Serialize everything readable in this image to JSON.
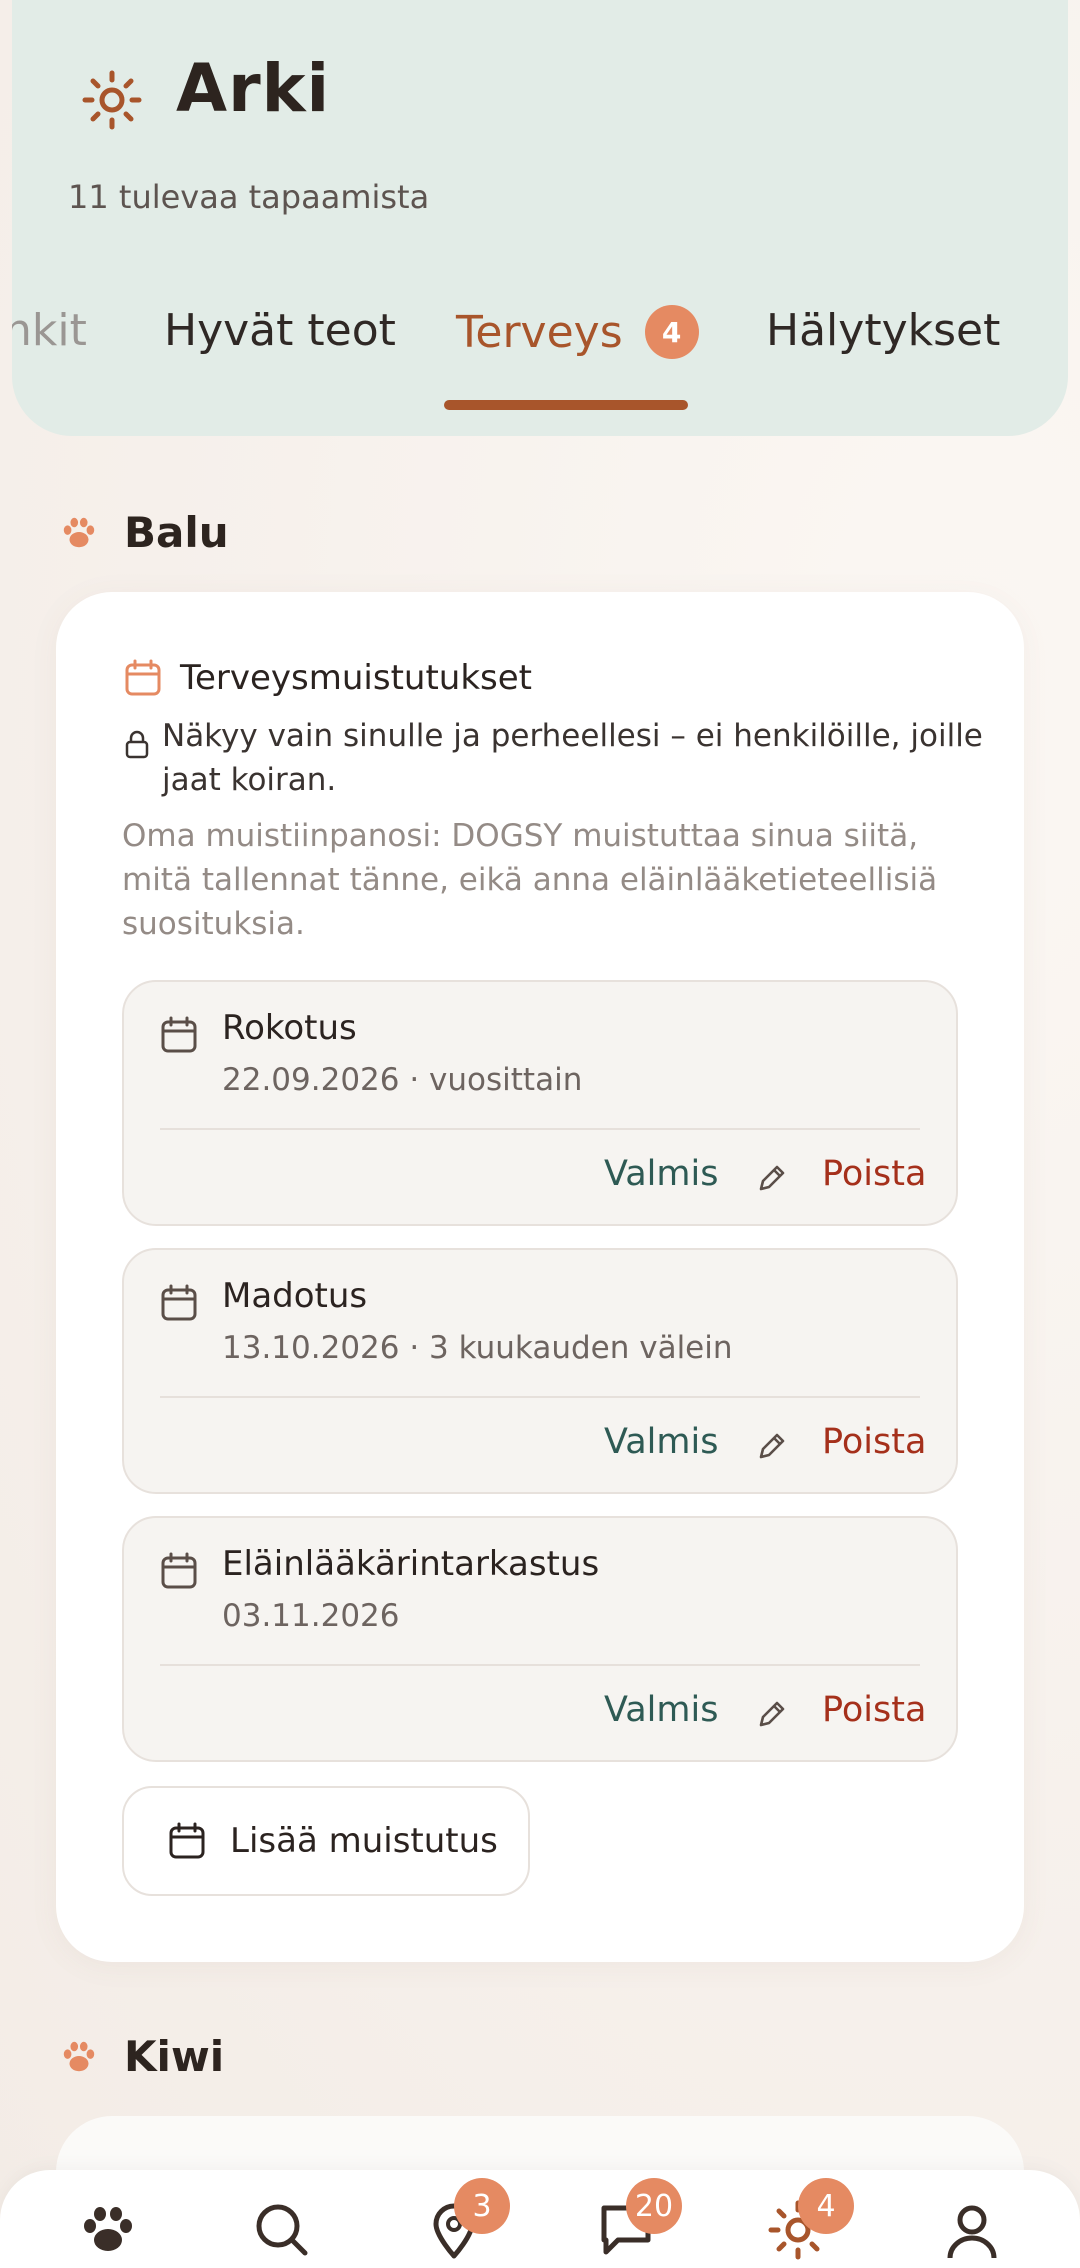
{
  "header": {
    "title": "Arki",
    "subtitle": "11 tulevaa tapaamista",
    "icon": "sun-icon"
  },
  "tabs": [
    {
      "label": "nkit",
      "state": "partial"
    },
    {
      "label": "Hyvät teot",
      "state": "normal"
    },
    {
      "label": "Terveys",
      "state": "active",
      "badge": "4"
    },
    {
      "label": "Hälytykset",
      "state": "normal"
    }
  ],
  "pets": [
    {
      "name": "Balu",
      "card": {
        "title": "Terveysmuistutukset",
        "privacy": "Näkyy vain sinulle ja perheellesi – ei henkilöille, joille jaat koiran.",
        "note": "Oma muistiinpanosi: DOGSY muistuttaa sinua siitä, mitä tallennat tänne, eikä anna eläinlääketieteellisiä suosituksia.",
        "reminders": [
          {
            "title": "Rokotus",
            "subtitle": "22.09.2026 · vuosittain",
            "done": "Valmis",
            "delete": "Poista"
          },
          {
            "title": "Madotus",
            "subtitle": "13.10.2026 · 3 kuukauden välein",
            "done": "Valmis",
            "delete": "Poista"
          },
          {
            "title": "Eläinlääkärintarkastus",
            "subtitle": "03.11.2026",
            "done": "Valmis",
            "delete": "Poista"
          }
        ],
        "add_label": "Lisää muistutus"
      }
    },
    {
      "name": "Kiwi"
    }
  ],
  "nav": [
    {
      "icon": "paw-icon",
      "badge": null
    },
    {
      "icon": "search-icon",
      "badge": null
    },
    {
      "icon": "map-pin-icon",
      "badge": "3"
    },
    {
      "icon": "chat-icon",
      "badge": "20"
    },
    {
      "icon": "sun-icon",
      "badge": "4"
    },
    {
      "icon": "profile-icon",
      "badge": null
    }
  ],
  "colors": {
    "accent": "#a8552b",
    "badge": "#e58a62",
    "header_bg": "#e2ece7",
    "done": "#2e5a54",
    "delete": "#a5301b"
  }
}
